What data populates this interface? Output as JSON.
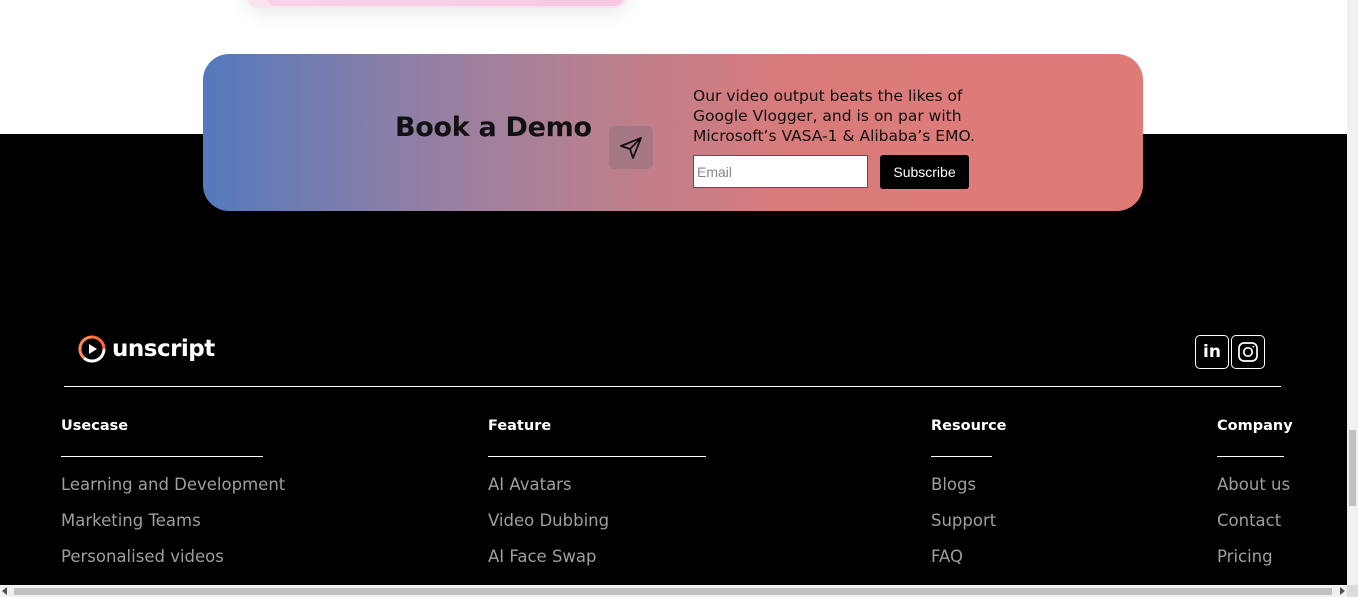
{
  "demo": {
    "title": "Book a Demo",
    "description": "Our video output beats the likes of Google Vlogger, and is on par with Microsoft’s VASA-1 & Alibaba’s EMO.",
    "email_placeholder": "Email",
    "subscribe_label": "Subscribe"
  },
  "brand": {
    "name": "unscript"
  },
  "social": {
    "linkedin_label": "in"
  },
  "footer": {
    "columns": [
      {
        "title": "Usecase",
        "items": [
          "Learning and Development",
          "Marketing Teams",
          "Personalised videos"
        ]
      },
      {
        "title": "Feature",
        "items": [
          "AI Avatars",
          "Video Dubbing",
          "AI Face Swap"
        ]
      },
      {
        "title": "Resource",
        "items": [
          "Blogs",
          "Support",
          "FAQ"
        ]
      },
      {
        "title": "Company",
        "items": [
          "About us",
          "Contact",
          "Pricing"
        ]
      }
    ]
  },
  "colors": {
    "footer_bg": "#000000",
    "gradient_start": "#5379bd",
    "gradient_end": "#df7b77",
    "link_gray": "#9e9e9e",
    "logo_accent": "#ff6a3d"
  }
}
